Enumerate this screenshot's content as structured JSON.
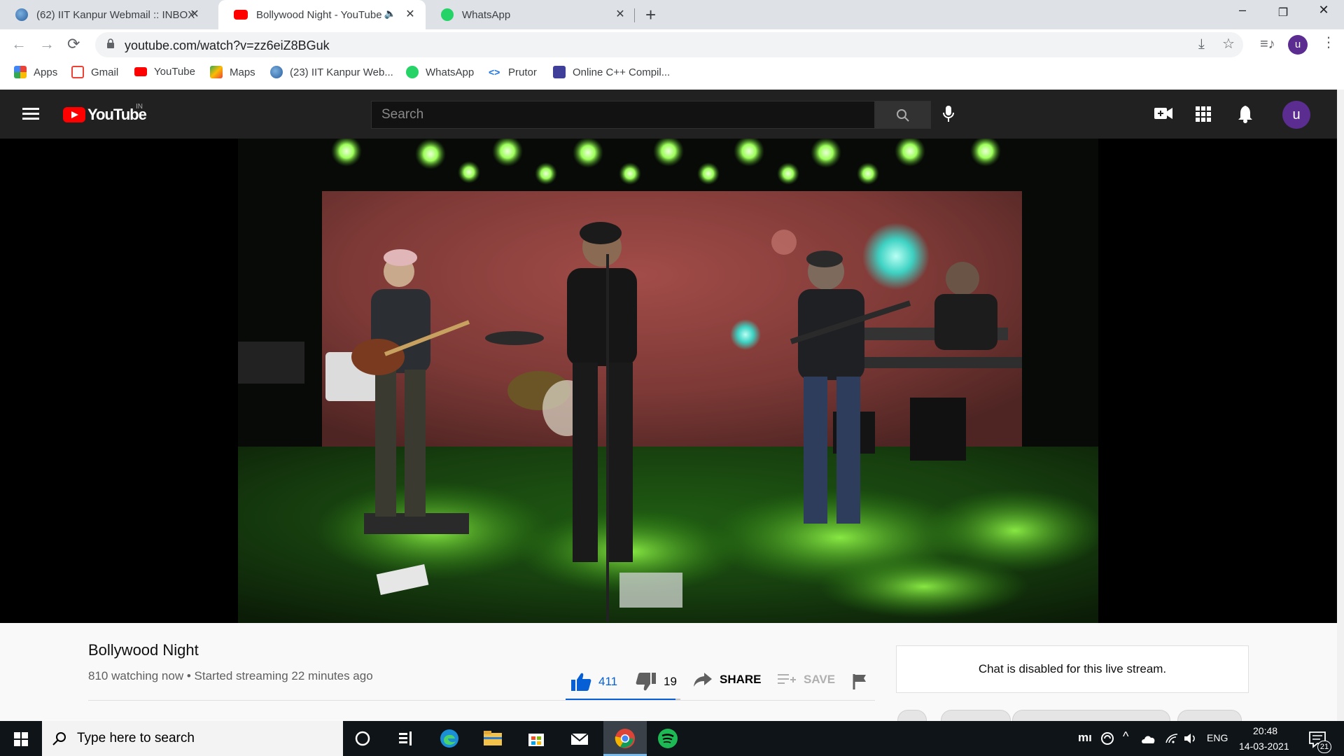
{
  "browser": {
    "tabs": [
      {
        "title": "(62) IIT Kanpur Webmail :: INBOX",
        "active": false
      },
      {
        "title": "Bollywood Night - YouTube",
        "active": true,
        "audio": true
      },
      {
        "title": "WhatsApp",
        "active": false
      }
    ],
    "url": "youtube.com/watch?v=zz6eiZ8BGuk",
    "profile_initial": "u",
    "bookmarks": [
      "Apps",
      "Gmail",
      "YouTube",
      "Maps",
      "(23) IIT Kanpur Web...",
      "WhatsApp",
      "Prutor",
      "Online C++ Compil..."
    ]
  },
  "youtube": {
    "logo_text": "YouTube",
    "country_code": "IN",
    "search_placeholder": "Search",
    "avatar_initial": "u"
  },
  "video": {
    "title": "Bollywood Night",
    "watching": "810 watching now",
    "separator": "•",
    "started": "Started streaming 22 minutes ago",
    "likes": "411",
    "dislikes": "19",
    "like_ratio": 0.956,
    "share_label": "SHARE",
    "save_label": "SAVE"
  },
  "chat": {
    "message": "Chat is disabled for this live stream."
  },
  "taskbar": {
    "search_placeholder": "Type here to search",
    "language": "ENG",
    "time": "20:48",
    "date": "14-03-2021",
    "notification_count": "21"
  },
  "colors": {
    "youtube_red": "#ff0000",
    "masthead": "#212121",
    "like_blue": "#065fd4",
    "avatar_purple": "#5c2d91",
    "stage_green": "#3fae1c",
    "backdrop_red": "#8a3f3c"
  }
}
